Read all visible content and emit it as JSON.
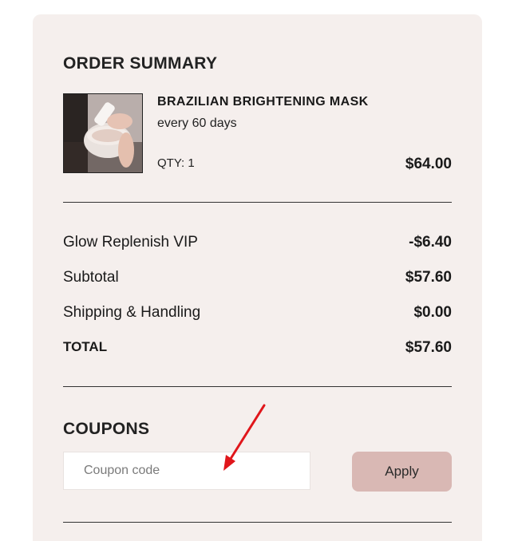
{
  "summary": {
    "title": "ORDER SUMMARY"
  },
  "product": {
    "name": "BRAZILIAN BRIGHTENING MASK",
    "frequency": "every 60 days",
    "qty": "QTY: 1",
    "price": "$64.00"
  },
  "totals": [
    {
      "label": "Glow Replenish VIP",
      "value": "-$6.40"
    },
    {
      "label": "Subtotal",
      "value": "$57.60"
    },
    {
      "label": "Shipping & Handling",
      "value": "$0.00"
    },
    {
      "label": "TOTAL",
      "value": "$57.60"
    }
  ],
  "coupons": {
    "title": "COUPONS",
    "placeholder": "Coupon code",
    "apply_label": "Apply",
    "apply_color": "#d9b8b4"
  },
  "annotation": {
    "arrow_color": "#e0161b"
  }
}
